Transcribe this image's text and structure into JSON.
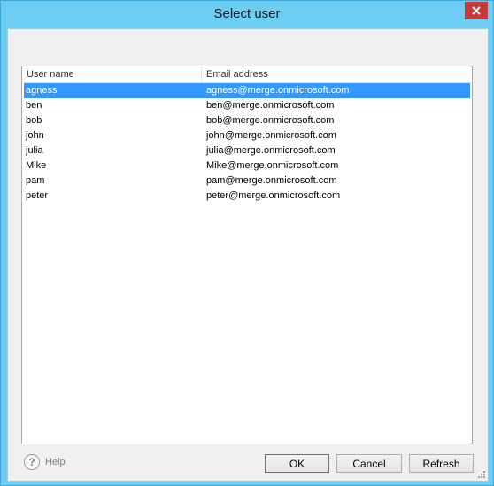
{
  "window": {
    "title": "Select user"
  },
  "list": {
    "columns": [
      "User name",
      "Email address"
    ],
    "rows": [
      {
        "name": "agness",
        "email": "agness@merge.onmicrosoft.com"
      },
      {
        "name": "ben",
        "email": "ben@merge.onmicrosoft.com"
      },
      {
        "name": "bob",
        "email": "bob@merge.onmicrosoft.com"
      },
      {
        "name": "john",
        "email": "john@merge.onmicrosoft.com"
      },
      {
        "name": "julia",
        "email": "julia@merge.onmicrosoft.com"
      },
      {
        "name": "Mike",
        "email": "Mike@merge.onmicrosoft.com"
      },
      {
        "name": "pam",
        "email": "pam@merge.onmicrosoft.com"
      },
      {
        "name": "peter",
        "email": "peter@merge.onmicrosoft.com"
      }
    ],
    "selected_index": 0
  },
  "footer": {
    "help_label": "Help",
    "help_icon": "?",
    "ok_label": "OK",
    "cancel_label": "Cancel",
    "refresh_label": "Refresh"
  },
  "colors": {
    "title_bar": "#6dcdf2",
    "selection": "#3399ff",
    "close_button": "#c7383a"
  }
}
